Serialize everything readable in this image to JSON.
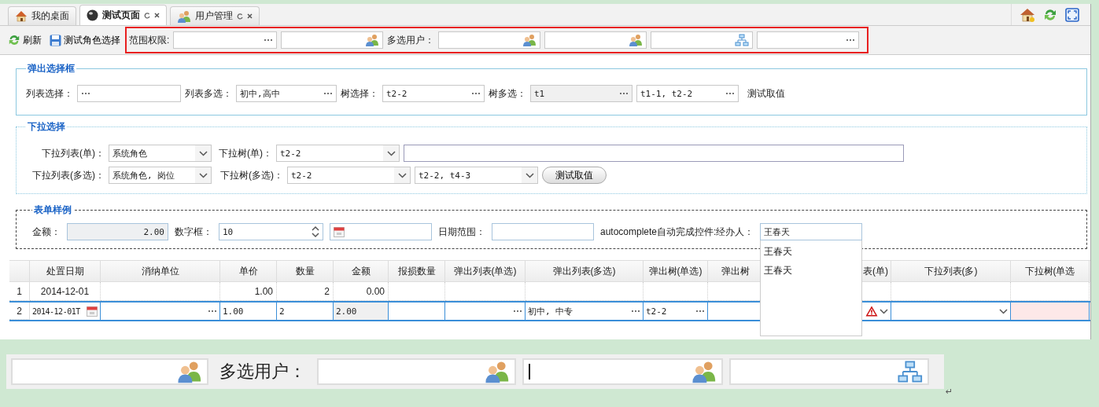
{
  "tabs": [
    {
      "label": "我的桌面",
      "closable": false,
      "selected": false
    },
    {
      "label": "测试页面",
      "closable": true,
      "selected": true
    },
    {
      "label": "用户管理",
      "closable": true,
      "selected": false
    }
  ],
  "toolbar": {
    "buttons": [
      {
        "label": "刷新"
      },
      {
        "label": "测试角色选择"
      }
    ],
    "controls": [
      {
        "kind": "label",
        "text": "范围权限:"
      },
      {
        "kind": "popup"
      },
      {
        "kind": "user"
      },
      {
        "kind": "label",
        "text": "多选用户："
      },
      {
        "kind": "user"
      },
      {
        "kind": "user"
      },
      {
        "kind": "tree"
      },
      {
        "kind": "popup"
      }
    ]
  },
  "popup_section": {
    "title": "弹出选择框",
    "fields": [
      {
        "label": "列表选择：",
        "disabled": false
      },
      {
        "label": "列表多选：",
        "value": "初中,高中",
        "disabled": false
      },
      {
        "label": "树选择：",
        "value": "t2-2",
        "disabled": false
      },
      {
        "label": "树多选：",
        "value": "t1",
        "disabled": true
      },
      {
        "value": "t1-1, t2-2",
        "disabled": false
      }
    ],
    "link": "测试取值"
  },
  "dropdown_section": {
    "title": "下拉选择",
    "rows": [
      [
        {
          "kind": "select",
          "label": "下拉列表(单)：",
          "value": "系统角色"
        },
        {
          "kind": "select",
          "label": "下拉树(单)：",
          "value": "t2-2"
        },
        {
          "kind": "text"
        }
      ],
      [
        {
          "kind": "select",
          "label": "下拉列表(多选)：",
          "value": "系统角色, 岗位"
        },
        {
          "kind": "select",
          "label": "下拉树(多选)：",
          "value": "t2-2"
        },
        {
          "kind": "select",
          "value": "t2-2, t4-3"
        },
        {
          "kind": "button",
          "label": "测试取值"
        }
      ]
    ]
  },
  "form_section": {
    "title": "表单样例",
    "fields": [
      {
        "kind": "text",
        "label": "金额：",
        "value": "2.00",
        "disabled": true
      },
      {
        "kind": "number",
        "label": "数字框：",
        "value": "10",
        "disabled": false
      },
      {
        "kind": "date",
        "disabled": false
      },
      {
        "kind": "text",
        "label": "日期范围：",
        "disabled": false
      },
      {
        "kind": "autocomplete",
        "label": "autocomplete自动完成控件:经办人：",
        "value": "王春天",
        "disabled": false,
        "options": [
          "王春天",
          "王春天"
        ]
      }
    ]
  },
  "grid": {
    "columns": [
      "处置日期",
      "消纳单位",
      "单价",
      "数量",
      "金额",
      "报损数量",
      "弹出列表(单选)",
      "弹出列表(多选)",
      "弹出树(单选)",
      "弹出树",
      "表(单)",
      "下拉列表(多)",
      "下拉树(单选"
    ],
    "rows": [
      {
        "number": "1",
        "editing": false,
        "cells": [
          {
            "value": "2014-12-01"
          },
          {},
          {
            "value": "1.00"
          },
          {
            "value": "2"
          },
          {
            "value": "0.00"
          },
          {},
          {},
          {},
          {},
          {},
          {},
          {},
          {}
        ]
      },
      {
        "number": "2",
        "editing": true,
        "cells": [
          {
            "kind": "date",
            "value": "2014-12-01T"
          },
          {
            "kind": "popup"
          },
          {
            "kind": "text",
            "value": "1.00"
          },
          {
            "kind": "text",
            "value": "2"
          },
          {
            "kind": "readonly",
            "value": "2.00"
          },
          {
            "kind": "text"
          },
          {
            "kind": "popup"
          },
          {
            "kind": "popup",
            "value": "初中, 中专"
          },
          {
            "kind": "popup",
            "value": "t2-2"
          },
          {
            "kind": "text"
          },
          {
            "kind": "select",
            "invalid": true
          },
          {
            "kind": "select",
            "invalid": false
          },
          {
            "kind": "text",
            "invalid": true
          }
        ]
      }
    ]
  },
  "zoom_strip": {
    "controls": [
      {
        "kind": "user"
      },
      {
        "kind": "label",
        "text": "多选用户："
      },
      {
        "kind": "user"
      },
      {
        "kind": "user",
        "focused": true
      },
      {
        "kind": "tree"
      }
    ],
    "mark": "↵"
  }
}
